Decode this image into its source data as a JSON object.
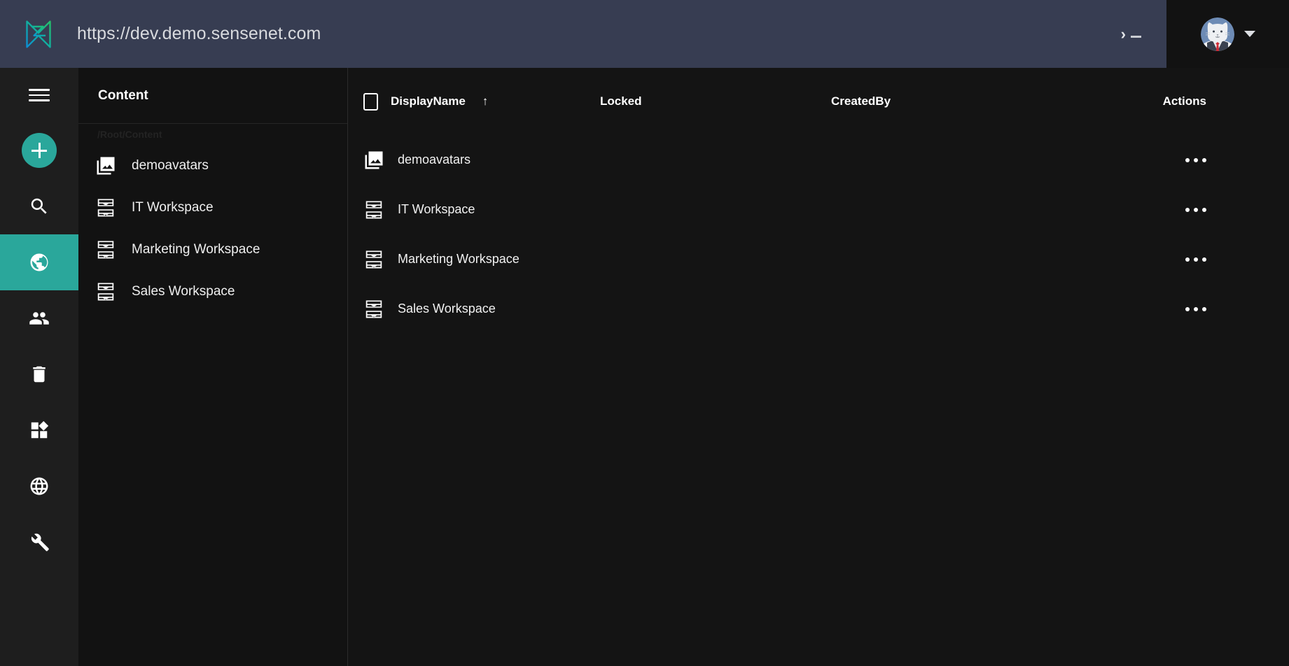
{
  "app": {
    "accent_color": "#2aa79b",
    "topbar_color": "#373d52",
    "background_color": "#121212"
  },
  "topbar": {
    "logo_name": "sensenet-logo",
    "url": "https://dev.demo.sensenet.com",
    "console_chevron": "›",
    "console_icon_name": "terminal-prompt-icon"
  },
  "user": {
    "avatar_name": "cat-avatar",
    "menu_chevron_name": "chevron-down-icon"
  },
  "rail": {
    "items": [
      {
        "icon": "hamburger-menu-icon",
        "name": "menu-toggle",
        "active": false
      },
      {
        "icon": "plus-icon",
        "name": "new-content-button",
        "active": false
      },
      {
        "icon": "search-icon",
        "name": "search-button",
        "active": false
      },
      {
        "icon": "globe-content-icon",
        "name": "content-button",
        "active": true
      },
      {
        "icon": "people-icon",
        "name": "users-button",
        "active": false
      },
      {
        "icon": "trash-icon",
        "name": "trash-button",
        "active": false
      },
      {
        "icon": "dashboard-icon",
        "name": "dashboard-button",
        "active": false
      },
      {
        "icon": "language-globe-icon",
        "name": "localization-button",
        "active": false
      },
      {
        "icon": "wrench-icon",
        "name": "setup-button",
        "active": false
      }
    ]
  },
  "tree": {
    "title": "Content",
    "breadcrumb": "/Root/Content",
    "items": [
      {
        "label": "demoavatars",
        "icon": "image-library-icon"
      },
      {
        "label": "IT Workspace",
        "icon": "workspace-icon"
      },
      {
        "label": "Marketing Workspace",
        "icon": "workspace-icon"
      },
      {
        "label": "Sales Workspace",
        "icon": "workspace-icon"
      }
    ]
  },
  "table": {
    "columns": {
      "display_name": "DisplayName",
      "sort_indicator": "↑",
      "locked": "Locked",
      "created_by": "CreatedBy",
      "actions": "Actions"
    },
    "rows": [
      {
        "display_name": "demoavatars",
        "icon": "image-library-icon",
        "locked": "",
        "created_by": ""
      },
      {
        "display_name": "IT Workspace",
        "icon": "workspace-icon",
        "locked": "",
        "created_by": ""
      },
      {
        "display_name": "Marketing Workspace",
        "icon": "workspace-icon",
        "locked": "",
        "created_by": ""
      },
      {
        "display_name": "Sales Workspace",
        "icon": "workspace-icon",
        "locked": "",
        "created_by": ""
      }
    ]
  }
}
